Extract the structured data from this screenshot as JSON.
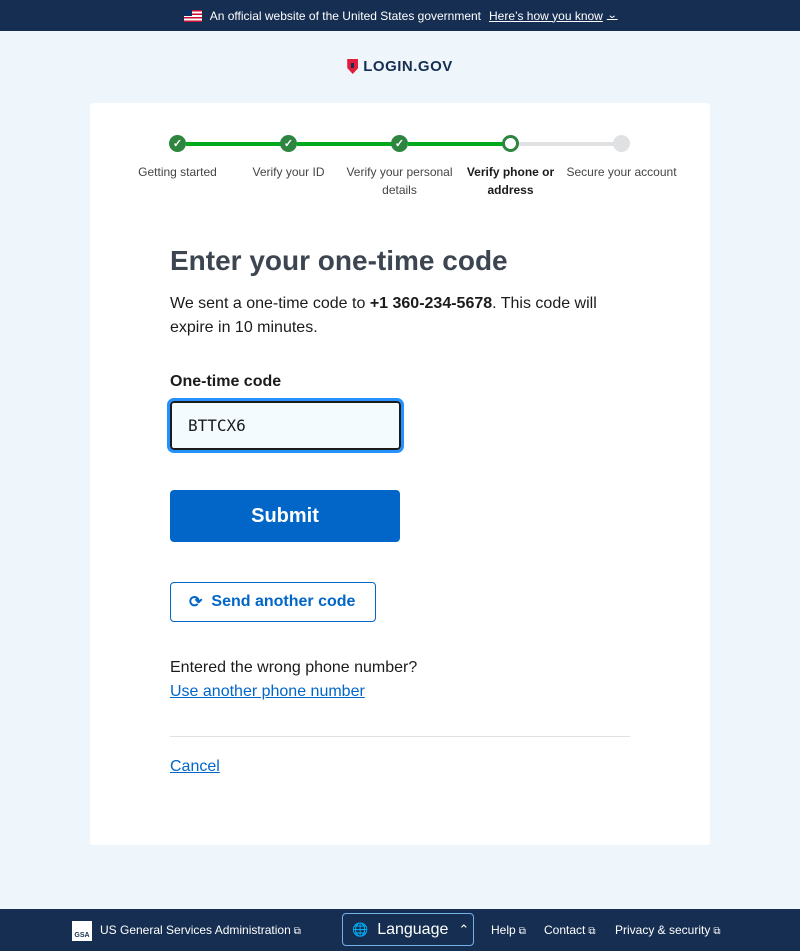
{
  "banner": {
    "text": "An official website of the United States government",
    "link": "Here’s how you know",
    "chevron": "⌄"
  },
  "logo": {
    "text": "LOGIN.GOV"
  },
  "steps": [
    {
      "label": "Getting started",
      "status": "complete"
    },
    {
      "label": "Verify your ID",
      "status": "complete"
    },
    {
      "label": "Verify your personal details",
      "status": "complete"
    },
    {
      "label": "Verify phone or address",
      "status": "current"
    },
    {
      "label": "Secure your account",
      "status": "incomplete"
    }
  ],
  "check_glyph": "✓",
  "main": {
    "title": "Enter your one-time code",
    "intro_before": "We sent a one-time code to ",
    "phone": "+1 360-234-5678",
    "intro_after": ". This code will expire in 10 minutes.",
    "field_label": "One-time code",
    "code_value": "BTTCX6",
    "submit": "Submit",
    "resend_icon": "⟳",
    "resend": "Send another code",
    "wrong_number_text": "Entered the wrong phone number?",
    "wrong_number_link": "Use another phone number",
    "cancel": "Cancel"
  },
  "footer": {
    "gsa_badge": "GSA",
    "gsa": "US General Services Administration",
    "ext_icon": "⧉",
    "globe_icon": "🌐",
    "language": "Language",
    "language_arrow": "⌃",
    "help": "Help",
    "contact": "Contact",
    "privacy": "Privacy & security"
  },
  "colors": {
    "primary": "#0166c7",
    "banner_bg": "#162e51",
    "success": "#2e8540",
    "page_bg": "#eff6fb"
  }
}
